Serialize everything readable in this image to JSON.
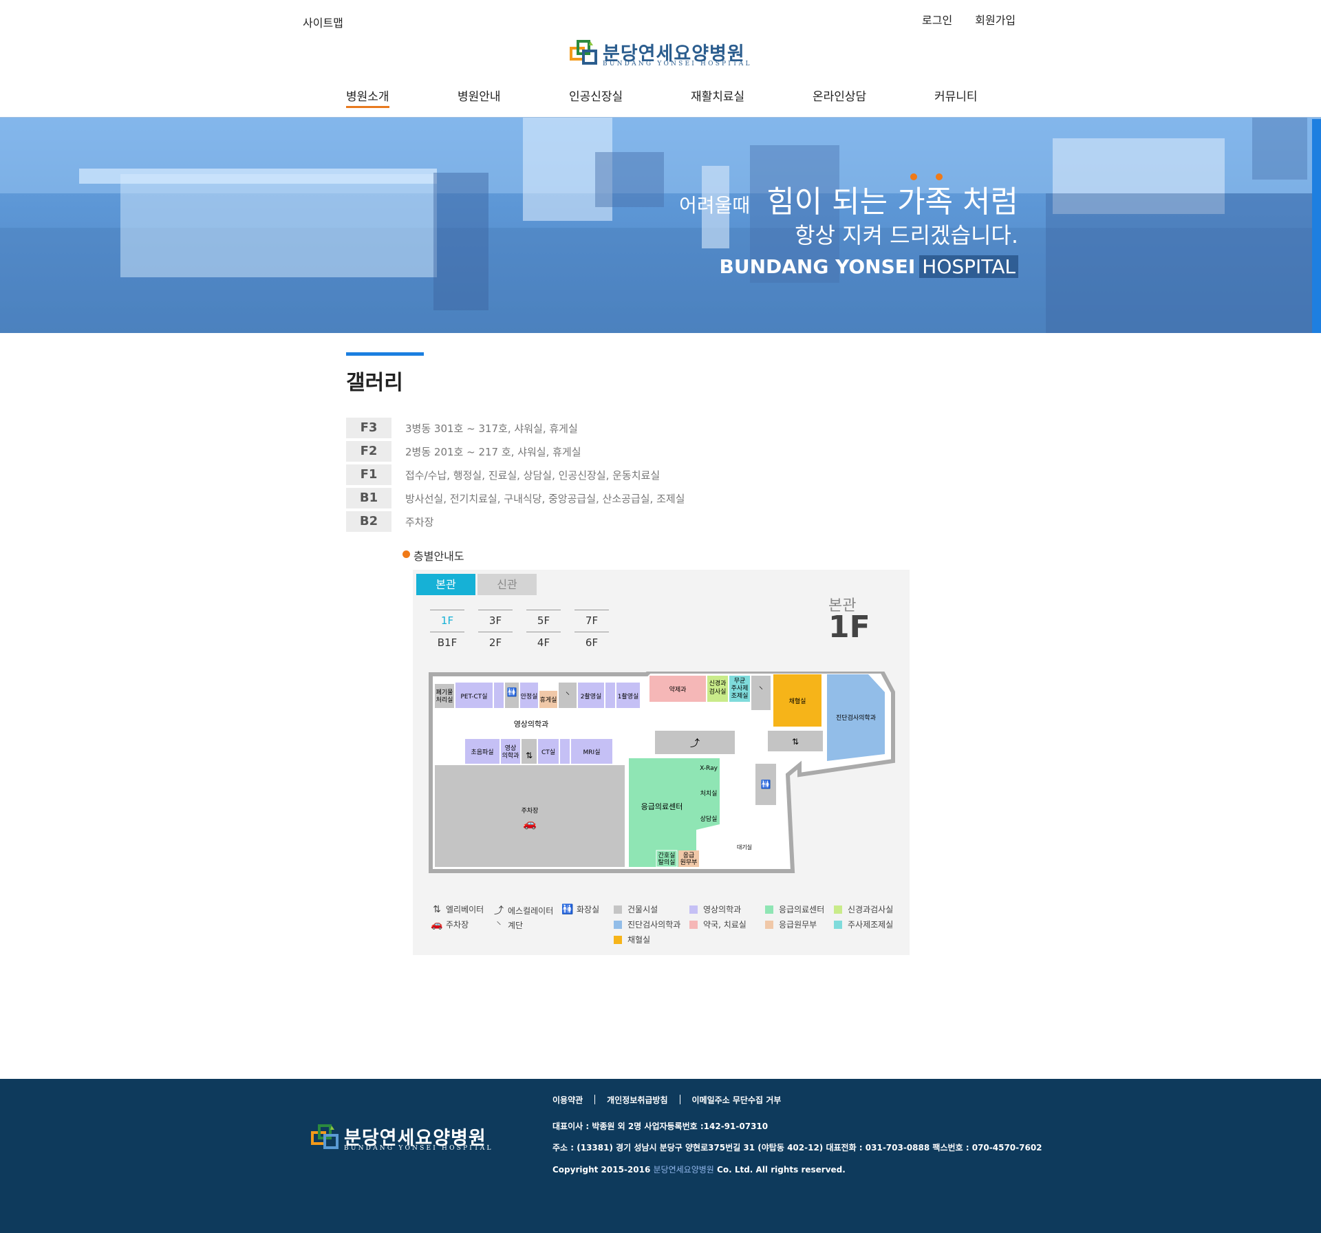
{
  "header": {
    "sitemap": "사이트맵",
    "login": "로그인",
    "signup": "회원가입",
    "logo_text": "분당연세요양병원",
    "logo_sub": "BUNDANG YONSEI HOSPITAL",
    "nav": [
      "병원소개",
      "병원안내",
      "인공신장실",
      "재활치료실",
      "온라인상담",
      "커뮤니티"
    ],
    "nav_active": "병원소개"
  },
  "banner": {
    "line1_small": "어려울때",
    "line1_big": "힘이 되는 가족 처럼",
    "line2": "항상 지켜 드리겠습니다.",
    "line3_bold": "BUNDANG YONSEI",
    "line3_light": "HOSPITAL"
  },
  "page": {
    "title": "갤러리",
    "floors": [
      {
        "floor": "F3",
        "desc": "3병동 301호 ~ 317호, 샤워실, 휴게실"
      },
      {
        "floor": "F2",
        "desc": "2병동 201호 ~ 217 호, 샤워실, 휴게실"
      },
      {
        "floor": "F1",
        "desc": "접수/수납, 행정실, 진료실, 상담실, 인공신장실, 운동치료실"
      },
      {
        "floor": "B1",
        "desc": "방사선실, 전기치료실, 구내식당, 중앙공급실, 산소공급실, 조제실"
      },
      {
        "floor": "B2",
        "desc": "주차장"
      }
    ]
  },
  "floormap": {
    "heading": "층별안내도",
    "tabs": [
      "본관",
      "신관"
    ],
    "floor_buttons_top": [
      "1F",
      "3F",
      "5F",
      "7F"
    ],
    "floor_buttons_bottom": [
      "B1F",
      "2F",
      "4F",
      "6F"
    ],
    "selected_floor": "1F",
    "current_building": "본관",
    "current_floor": "1F",
    "rooms": {
      "waste": "폐기물 처리실",
      "petct": "PET-CT실",
      "jojeong1": "조정실",
      "anjeong": "안정실",
      "hyugae": "휴게실",
      "trial2": "2촬영실",
      "jojeong2": "조정실",
      "trial1": "1촬영실",
      "pharmacy": "약제과",
      "neuro": "신경과 검사실",
      "sterile": "무균 주사제 조제실",
      "blood": "채혈실",
      "diag": "진단검사의학과",
      "imaging": "영상의학과",
      "ultra": "초음파실",
      "imaging_small": "영상 의학과",
      "ct": "CT실",
      "jojeong3": "조정실",
      "mri": "MRI실",
      "parking": "주차장",
      "er": "응급의료센터",
      "xray": "X-Ray",
      "treat": "처치실",
      "consult": "상담실",
      "waiting": "대기실",
      "nurse": "간호실 탈의실",
      "er_office": "응급 원무부"
    },
    "legend": {
      "elevator": "엘리베이터",
      "escalator": "에스컬레이터",
      "restroom": "화장실",
      "parking": "주차장",
      "stairs": "계단",
      "items": [
        {
          "label": "건물시설",
          "color": "#c4c4c4"
        },
        {
          "label": "영상의학과",
          "color": "#c5c0f5"
        },
        {
          "label": "응급의료센터",
          "color": "#8fe5b4"
        },
        {
          "label": "신경과검사실",
          "color": "#c9eb8a"
        },
        {
          "label": "진단검사의학과",
          "color": "#92bde8"
        },
        {
          "label": "약국, 치료실",
          "color": "#f5b7b7"
        },
        {
          "label": "응급원무부",
          "color": "#f0c8a8"
        },
        {
          "label": "주사제조제실",
          "color": "#7fdbdb"
        },
        {
          "label": "채혈실",
          "color": "#f6b419"
        }
      ]
    }
  },
  "footer": {
    "links": [
      "이용약관",
      "개인정보취급방침",
      "이메일주소 무단수집 거부"
    ],
    "line1": "대표이사 : 박종원 외 2명 사업자등록번호 :142-91-07310",
    "line2": "주소 : (13381) 경기 성남시 분당구 양현로375번길 31 (야탑동 402-12)  대표전화 : 031-703-0888  팩스번호 : 070-4570-7602",
    "copyright_pre": "Copyright 2015-2016",
    "copyright_name": "분당연세요양병원",
    "copyright_post": "Co. Ltd. All rights reserved.",
    "logo_text": "분당연세요양병원",
    "logo_sub": "BUNDANG YONSEI HOSPITAL"
  },
  "colors": {
    "accent_blue": "#1b7fe0",
    "accent_orange": "#f07a18",
    "tab_active": "#16b1d6",
    "footer_bg": "#0e3a5c"
  }
}
